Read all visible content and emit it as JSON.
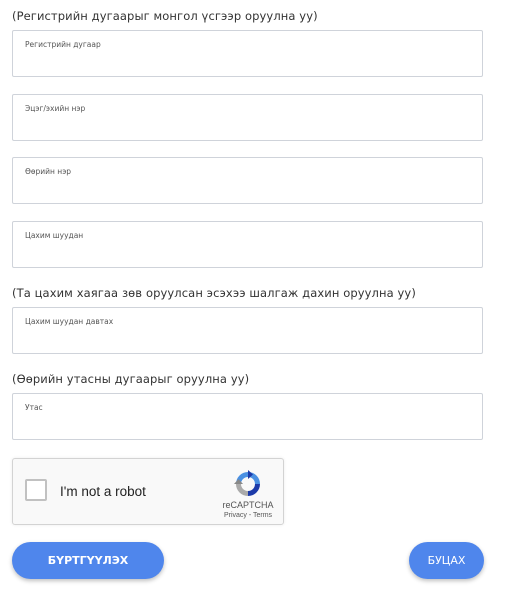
{
  "hints": {
    "register_hint": "(Регистрийн дугаарыг монгол үсгээр оруулна уу)",
    "email_hint": "(Та цахим хаягаа зөв оруулсан эсэхээ шалгаж дахин оруулна уу)",
    "phone_hint": "(Өөрийн утасны дугаарыг оруулна уу)"
  },
  "fields": {
    "register": {
      "label": "Регистрийн дугаар",
      "value": ""
    },
    "surname": {
      "label": "Эцэг/эхийн нэр",
      "value": ""
    },
    "firstname": {
      "label": "Өөрийн нэр",
      "value": ""
    },
    "email": {
      "label": "Цахим шуудан",
      "value": ""
    },
    "email_confirm": {
      "label": "Цахим шуудан давтах",
      "value": ""
    },
    "phone": {
      "label": "Утас",
      "value": ""
    }
  },
  "recaptcha": {
    "checkbox_label": "I'm not a robot",
    "brand": "reCAPTCHA",
    "links": "Privacy - Terms"
  },
  "buttons": {
    "register": "БҮРТГҮҮЛЭХ",
    "back": "БУЦАХ"
  },
  "colors": {
    "button_blue": "#4f86ec",
    "border": "#cfd3da"
  }
}
